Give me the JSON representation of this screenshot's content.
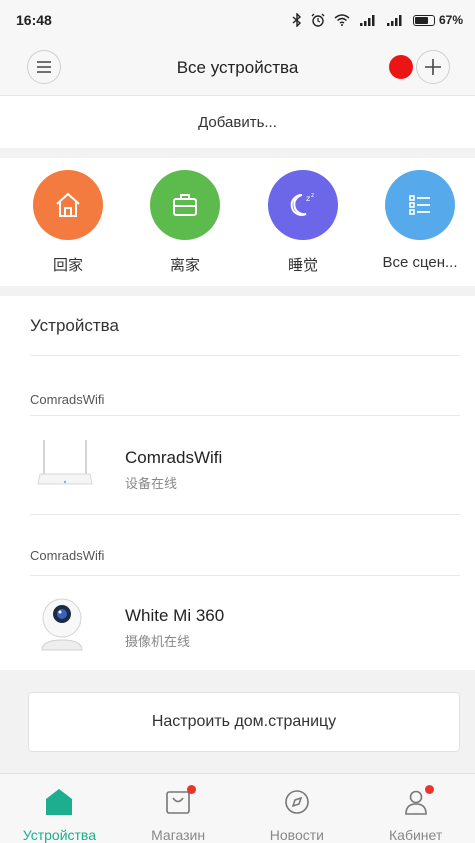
{
  "status_bar": {
    "time": "16:48",
    "battery_percent": "67%",
    "icons": [
      "bluetooth-icon",
      "alarm-icon",
      "wifi-icon",
      "signal-icon",
      "signal-icon",
      "battery-icon"
    ]
  },
  "header": {
    "title": "Все устройства",
    "menu_icon": "menu-icon",
    "add_icon": "plus-icon",
    "record_indicator_color": "#ec1515"
  },
  "add_strip": {
    "label": "Добавить..."
  },
  "scenes": [
    {
      "label": "回家",
      "icon": "home-icon",
      "color": "#f47b3f"
    },
    {
      "label": "离家",
      "icon": "briefcase-icon",
      "color": "#5dbb4d"
    },
    {
      "label": "睡觉",
      "icon": "moon-icon",
      "color": "#6b67e8"
    },
    {
      "label": "Все сцен...",
      "icon": "list-icon",
      "color": "#56a9ea"
    }
  ],
  "devices": {
    "title": "Устройства",
    "groups": [
      {
        "label": "ComradsWifi",
        "device": {
          "name": "ComradsWifi",
          "status": "设备在线",
          "icon": "router-icon"
        }
      },
      {
        "label": "ComradsWifi",
        "device": {
          "name": "White Mi 360",
          "status": "摄像机在线",
          "icon": "camera-icon"
        }
      }
    ]
  },
  "customize": {
    "label": "Настроить дом.страницу"
  },
  "bottom_nav": {
    "accent_color": "#1cae8e",
    "items": [
      {
        "label": "Устройства",
        "icon": "home-icon",
        "active": true,
        "badge": false
      },
      {
        "label": "Магазин",
        "icon": "shop-icon",
        "active": false,
        "badge": true
      },
      {
        "label": "Новости",
        "icon": "compass-icon",
        "active": false,
        "badge": false
      },
      {
        "label": "Кабинет",
        "icon": "profile-icon",
        "active": false,
        "badge": true
      }
    ]
  }
}
